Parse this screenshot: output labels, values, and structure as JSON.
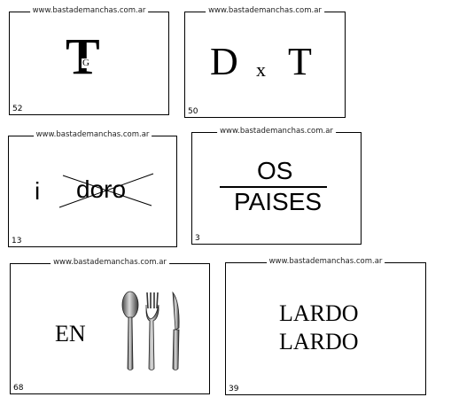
{
  "site": "www.bastademanchas.com.ar",
  "cards": {
    "c52": {
      "number": "52",
      "big_letter": "T",
      "small_letter": "G"
    },
    "c50": {
      "number": "50",
      "left": "D",
      "x": "x",
      "right": "T"
    },
    "c13": {
      "number": "13",
      "prefix": "i",
      "word": "doro"
    },
    "c3": {
      "number": "3",
      "top": "OS",
      "bottom": "PAISES"
    },
    "c68": {
      "number": "68",
      "word": "EN",
      "icon": "cutlery-icon"
    },
    "c39": {
      "number": "39",
      "line1": "LARDO",
      "line2": "LARDO"
    }
  }
}
